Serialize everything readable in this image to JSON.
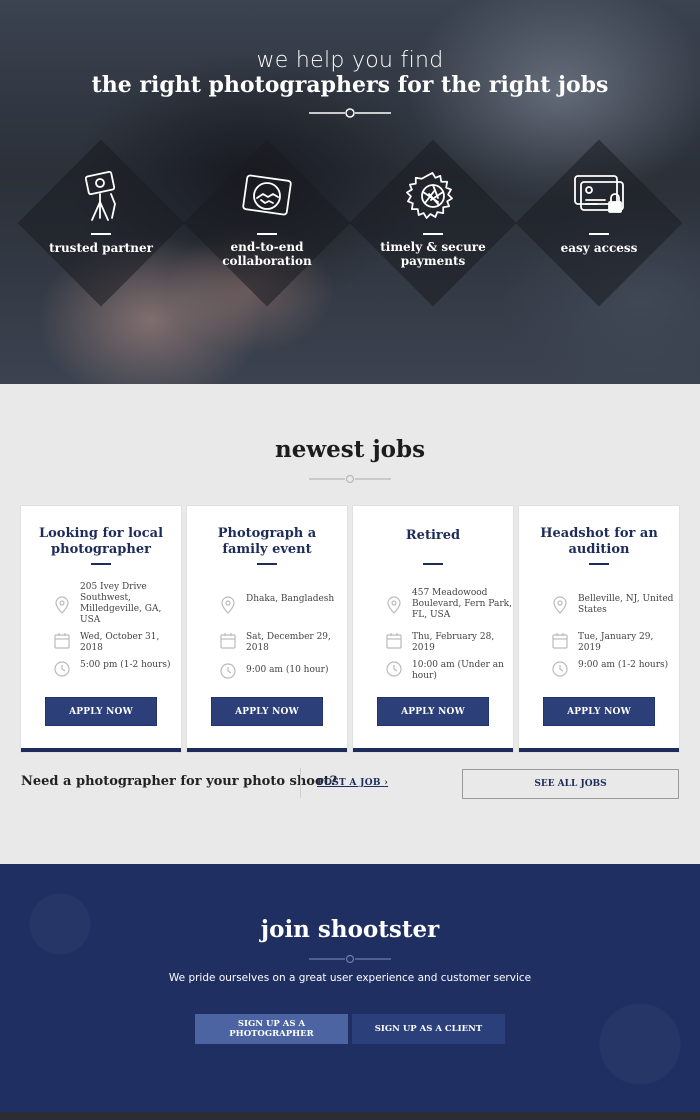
{
  "hero": {
    "title_small": "we help you find",
    "title_large": "the right photographers for the right jobs",
    "features": [
      {
        "label": "trusted partner",
        "icon": "photographer-tripod-icon"
      },
      {
        "label": "end-to-end\ncollaboration",
        "icon": "handshake-icon"
      },
      {
        "label": "timely & secure\npayments",
        "icon": "shutter-icon"
      },
      {
        "label": "easy access",
        "icon": "credit-card-lock-icon"
      }
    ]
  },
  "jobs": {
    "heading": "newest jobs",
    "cards": [
      {
        "title": "Looking for local photographer",
        "location": "205 Ivey Drive Southwest, Milledgeville, GA, USA",
        "date": "Wed, October 31, 2018",
        "time": "5:00 pm (1-2 hours)",
        "apply": "APPLY NOW"
      },
      {
        "title": "Photograph a family event",
        "location": "Dhaka, Bangladesh",
        "date": "Sat, December 29, 2018",
        "time": "9:00 am (10 hour)",
        "apply": "APPLY NOW"
      },
      {
        "title": "Retired",
        "location": "457 Meadowood Boulevard, Fern Park, FL, USA",
        "date": "Thu, February 28, 2019",
        "time": "10:00 am (Under an hour)",
        "apply": "APPLY NOW"
      },
      {
        "title": "Headshot for an audition",
        "location": "Belleville, NJ, United States",
        "date": "Tue, January 29, 2019",
        "time": "9:00 am (1-2 hours)",
        "apply": "APPLY NOW"
      }
    ],
    "cta_text": "Need a photographer for your photo shoot?",
    "post_job": "POST A JOB",
    "see_all": "SEE ALL JOBS"
  },
  "join": {
    "title": "join shootster",
    "subtitle": "We pride ourselves on a great user experience and customer service",
    "photographer_button": "SIGN UP AS A PHOTOGRAPHER",
    "client_button": "SIGN UP AS A CLIENT"
  },
  "colors": {
    "navy": "#1e2c5b",
    "join_bg": "#1f2f62",
    "button_light": "#4d64a3"
  }
}
